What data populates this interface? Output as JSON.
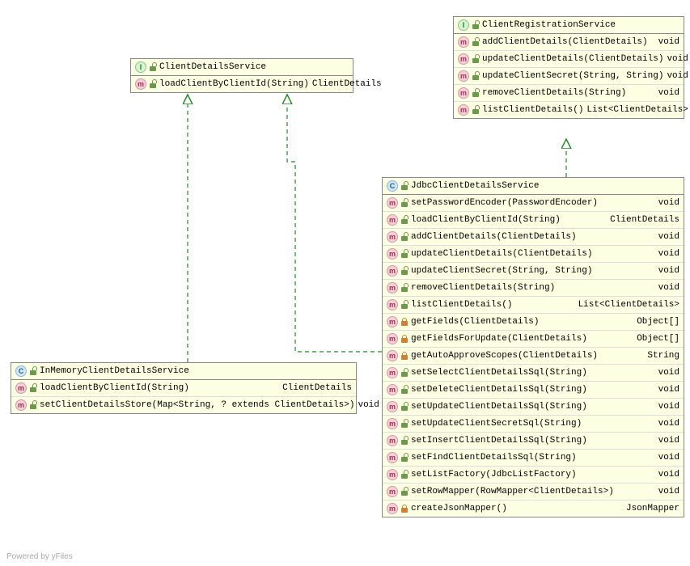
{
  "footer": "Powered by yFiles",
  "colors": {
    "arrow": "#1e8c1e",
    "box_bg": "#fdffe3"
  },
  "classes": {
    "clientDetailsService": {
      "kind": "interface",
      "name": "ClientDetailsService",
      "methods": [
        {
          "vis": "open",
          "sig": "loadClientByClientId(String)",
          "ret": "ClientDetails"
        }
      ]
    },
    "clientRegistrationService": {
      "kind": "interface",
      "name": "ClientRegistrationService",
      "methods": [
        {
          "vis": "open",
          "sig": "addClientDetails(ClientDetails)",
          "ret": "void"
        },
        {
          "vis": "open",
          "sig": "updateClientDetails(ClientDetails)",
          "ret": "void"
        },
        {
          "vis": "open",
          "sig": "updateClientSecret(String, String)",
          "ret": "void"
        },
        {
          "vis": "open",
          "sig": "removeClientDetails(String)",
          "ret": "void"
        },
        {
          "vis": "open",
          "sig": "listClientDetails()",
          "ret": "List<ClientDetails>"
        }
      ]
    },
    "inMemoryClientDetailsService": {
      "kind": "class",
      "name": "InMemoryClientDetailsService",
      "methods": [
        {
          "vis": "open",
          "sig": "loadClientByClientId(String)",
          "ret": "ClientDetails"
        },
        {
          "vis": "open",
          "sig": "setClientDetailsStore(Map<String, ? extends ClientDetails>)",
          "ret": "void"
        }
      ]
    },
    "jdbcClientDetailsService": {
      "kind": "class",
      "name": "JdbcClientDetailsService",
      "methods": [
        {
          "vis": "open",
          "sig": "setPasswordEncoder(PasswordEncoder)",
          "ret": "void"
        },
        {
          "vis": "open",
          "sig": "loadClientByClientId(String)",
          "ret": "ClientDetails"
        },
        {
          "vis": "open",
          "sig": "addClientDetails(ClientDetails)",
          "ret": "void"
        },
        {
          "vis": "open",
          "sig": "updateClientDetails(ClientDetails)",
          "ret": "void"
        },
        {
          "vis": "open",
          "sig": "updateClientSecret(String, String)",
          "ret": "void"
        },
        {
          "vis": "open",
          "sig": "removeClientDetails(String)",
          "ret": "void"
        },
        {
          "vis": "open",
          "sig": "listClientDetails()",
          "ret": "List<ClientDetails>"
        },
        {
          "vis": "locked",
          "sig": "getFields(ClientDetails)",
          "ret": "Object[]"
        },
        {
          "vis": "locked",
          "sig": "getFieldsForUpdate(ClientDetails)",
          "ret": "Object[]"
        },
        {
          "vis": "locked",
          "sig": "getAutoApproveScopes(ClientDetails)",
          "ret": "String"
        },
        {
          "vis": "open",
          "sig": "setSelectClientDetailsSql(String)",
          "ret": "void"
        },
        {
          "vis": "open",
          "sig": "setDeleteClientDetailsSql(String)",
          "ret": "void"
        },
        {
          "vis": "open",
          "sig": "setUpdateClientDetailsSql(String)",
          "ret": "void"
        },
        {
          "vis": "open",
          "sig": "setUpdateClientSecretSql(String)",
          "ret": "void"
        },
        {
          "vis": "open",
          "sig": "setInsertClientDetailsSql(String)",
          "ret": "void"
        },
        {
          "vis": "open",
          "sig": "setFindClientDetailsSql(String)",
          "ret": "void"
        },
        {
          "vis": "open",
          "sig": "setListFactory(JdbcListFactory)",
          "ret": "void"
        },
        {
          "vis": "open",
          "sig": "setRowMapper(RowMapper<ClientDetails>)",
          "ret": "void"
        },
        {
          "vis": "locked",
          "sig": "createJsonMapper()",
          "ret": "JsonMapper"
        }
      ]
    }
  }
}
